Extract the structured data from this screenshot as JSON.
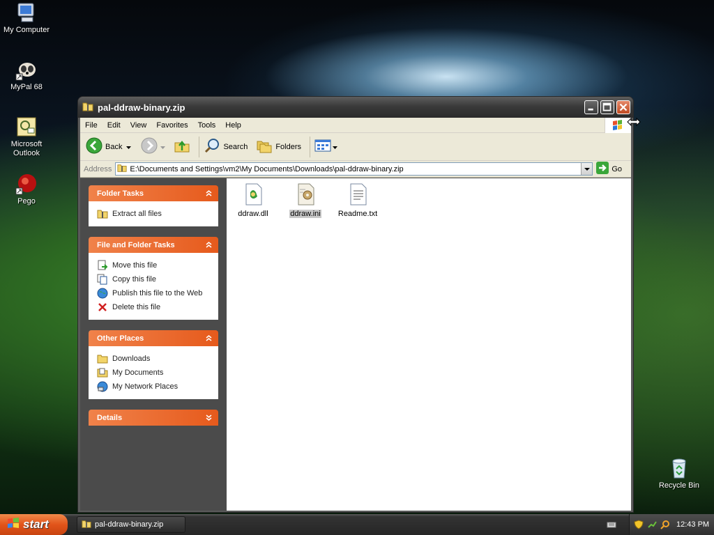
{
  "desktop": {
    "icons": [
      {
        "label": "My Computer"
      },
      {
        "label": "MyPal 68"
      },
      {
        "label": "Microsoft Outlook"
      },
      {
        "label": "Pego"
      },
      {
        "label": "Recycle Bin"
      }
    ]
  },
  "window": {
    "title": "pal-ddraw-binary.zip",
    "menu": [
      "File",
      "Edit",
      "View",
      "Favorites",
      "Tools",
      "Help"
    ],
    "toolbar": {
      "back": "Back",
      "search": "Search",
      "folders": "Folders"
    },
    "address": {
      "label": "Address",
      "value": "E:\\Documents and Settings\\vm2\\My Documents\\Downloads\\pal-ddraw-binary.zip",
      "go": "Go"
    },
    "panels": {
      "folder_tasks": {
        "title": "Folder Tasks",
        "items": [
          "Extract all files"
        ]
      },
      "file_tasks": {
        "title": "File and Folder Tasks",
        "items": [
          "Move this file",
          "Copy this file",
          "Publish this file to the Web",
          "Delete this file"
        ]
      },
      "other_places": {
        "title": "Other Places",
        "items": [
          "Downloads",
          "My Documents",
          "My Network Places"
        ]
      },
      "details": {
        "title": "Details"
      }
    },
    "files": [
      {
        "name": "ddraw.dll"
      },
      {
        "name": "ddraw.ini",
        "selected": true
      },
      {
        "name": "Readme.txt"
      }
    ]
  },
  "taskbar": {
    "start": "start",
    "task": "pal-ddraw-binary.zip",
    "clock": "12:43 PM"
  },
  "colors": {
    "accent": "#e65a1c",
    "taskpane": "#4b4b4b"
  }
}
